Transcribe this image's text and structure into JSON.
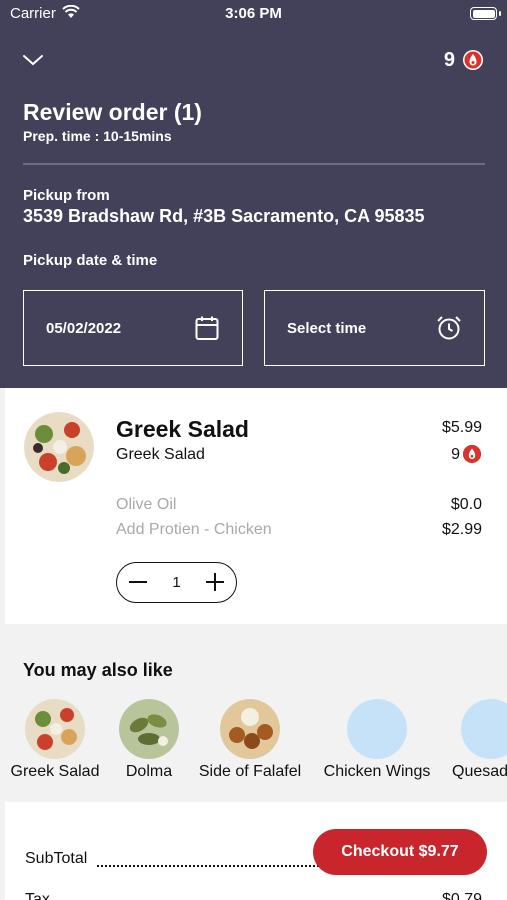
{
  "status_bar": {
    "carrier": "Carrier",
    "time": "3:06 PM"
  },
  "header": {
    "points": "9",
    "title": "Review order (1)",
    "prep_time": "Prep. time : 10-15mins",
    "pickup_label": "Pickup from",
    "pickup_address": "3539 Bradshaw Rd, #3B Sacramento, CA 95835",
    "pickup_datetime_label": "Pickup date & time",
    "date_value": "05/02/2022",
    "time_placeholder": "Select time"
  },
  "order_item": {
    "name": "Greek Salad",
    "subtitle": "Greek Salad",
    "price": "$5.99",
    "points": "9",
    "modifiers": [
      {
        "label": "Olive Oil",
        "price": "$0.0"
      },
      {
        "label": "Add Protien - Chicken",
        "price": "$2.99"
      }
    ],
    "quantity": "1"
  },
  "suggestions": {
    "title": "You may also like",
    "items": [
      {
        "label": "Greek Salad"
      },
      {
        "label": "Dolma"
      },
      {
        "label": "Side of Falafel"
      },
      {
        "label": "Chicken Wings"
      },
      {
        "label": "Quesad"
      }
    ]
  },
  "summary": {
    "subtotal_label": "SubTotal",
    "tax_label": "Tax",
    "tax_value": "$0.79",
    "checkout_label": "Checkout $9.77"
  },
  "colors": {
    "header_bg": "#43405a",
    "accent_red": "#c8262c",
    "placeholder_blue": "#c6e2f9"
  }
}
